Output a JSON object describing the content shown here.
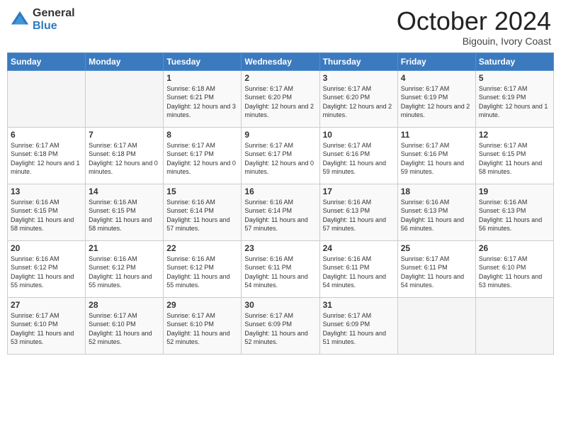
{
  "logo": {
    "general": "General",
    "blue": "Blue"
  },
  "title": "October 2024",
  "location": "Bigouin, Ivory Coast",
  "headers": [
    "Sunday",
    "Monday",
    "Tuesday",
    "Wednesday",
    "Thursday",
    "Friday",
    "Saturday"
  ],
  "weeks": [
    [
      {
        "day": "",
        "info": ""
      },
      {
        "day": "",
        "info": ""
      },
      {
        "day": "1",
        "info": "Sunrise: 6:18 AM\nSunset: 6:21 PM\nDaylight: 12 hours and 3 minutes."
      },
      {
        "day": "2",
        "info": "Sunrise: 6:17 AM\nSunset: 6:20 PM\nDaylight: 12 hours and 2 minutes."
      },
      {
        "day": "3",
        "info": "Sunrise: 6:17 AM\nSunset: 6:20 PM\nDaylight: 12 hours and 2 minutes."
      },
      {
        "day": "4",
        "info": "Sunrise: 6:17 AM\nSunset: 6:19 PM\nDaylight: 12 hours and 2 minutes."
      },
      {
        "day": "5",
        "info": "Sunrise: 6:17 AM\nSunset: 6:19 PM\nDaylight: 12 hours and 1 minute."
      }
    ],
    [
      {
        "day": "6",
        "info": "Sunrise: 6:17 AM\nSunset: 6:18 PM\nDaylight: 12 hours and 1 minute."
      },
      {
        "day": "7",
        "info": "Sunrise: 6:17 AM\nSunset: 6:18 PM\nDaylight: 12 hours and 0 minutes."
      },
      {
        "day": "8",
        "info": "Sunrise: 6:17 AM\nSunset: 6:17 PM\nDaylight: 12 hours and 0 minutes."
      },
      {
        "day": "9",
        "info": "Sunrise: 6:17 AM\nSunset: 6:17 PM\nDaylight: 12 hours and 0 minutes."
      },
      {
        "day": "10",
        "info": "Sunrise: 6:17 AM\nSunset: 6:16 PM\nDaylight: 11 hours and 59 minutes."
      },
      {
        "day": "11",
        "info": "Sunrise: 6:17 AM\nSunset: 6:16 PM\nDaylight: 11 hours and 59 minutes."
      },
      {
        "day": "12",
        "info": "Sunrise: 6:17 AM\nSunset: 6:15 PM\nDaylight: 11 hours and 58 minutes."
      }
    ],
    [
      {
        "day": "13",
        "info": "Sunrise: 6:16 AM\nSunset: 6:15 PM\nDaylight: 11 hours and 58 minutes."
      },
      {
        "day": "14",
        "info": "Sunrise: 6:16 AM\nSunset: 6:15 PM\nDaylight: 11 hours and 58 minutes."
      },
      {
        "day": "15",
        "info": "Sunrise: 6:16 AM\nSunset: 6:14 PM\nDaylight: 11 hours and 57 minutes."
      },
      {
        "day": "16",
        "info": "Sunrise: 6:16 AM\nSunset: 6:14 PM\nDaylight: 11 hours and 57 minutes."
      },
      {
        "day": "17",
        "info": "Sunrise: 6:16 AM\nSunset: 6:13 PM\nDaylight: 11 hours and 57 minutes."
      },
      {
        "day": "18",
        "info": "Sunrise: 6:16 AM\nSunset: 6:13 PM\nDaylight: 11 hours and 56 minutes."
      },
      {
        "day": "19",
        "info": "Sunrise: 6:16 AM\nSunset: 6:13 PM\nDaylight: 11 hours and 56 minutes."
      }
    ],
    [
      {
        "day": "20",
        "info": "Sunrise: 6:16 AM\nSunset: 6:12 PM\nDaylight: 11 hours and 55 minutes."
      },
      {
        "day": "21",
        "info": "Sunrise: 6:16 AM\nSunset: 6:12 PM\nDaylight: 11 hours and 55 minutes."
      },
      {
        "day": "22",
        "info": "Sunrise: 6:16 AM\nSunset: 6:12 PM\nDaylight: 11 hours and 55 minutes."
      },
      {
        "day": "23",
        "info": "Sunrise: 6:16 AM\nSunset: 6:11 PM\nDaylight: 11 hours and 54 minutes."
      },
      {
        "day": "24",
        "info": "Sunrise: 6:16 AM\nSunset: 6:11 PM\nDaylight: 11 hours and 54 minutes."
      },
      {
        "day": "25",
        "info": "Sunrise: 6:17 AM\nSunset: 6:11 PM\nDaylight: 11 hours and 54 minutes."
      },
      {
        "day": "26",
        "info": "Sunrise: 6:17 AM\nSunset: 6:10 PM\nDaylight: 11 hours and 53 minutes."
      }
    ],
    [
      {
        "day": "27",
        "info": "Sunrise: 6:17 AM\nSunset: 6:10 PM\nDaylight: 11 hours and 53 minutes."
      },
      {
        "day": "28",
        "info": "Sunrise: 6:17 AM\nSunset: 6:10 PM\nDaylight: 11 hours and 52 minutes."
      },
      {
        "day": "29",
        "info": "Sunrise: 6:17 AM\nSunset: 6:10 PM\nDaylight: 11 hours and 52 minutes."
      },
      {
        "day": "30",
        "info": "Sunrise: 6:17 AM\nSunset: 6:09 PM\nDaylight: 11 hours and 52 minutes."
      },
      {
        "day": "31",
        "info": "Sunrise: 6:17 AM\nSunset: 6:09 PM\nDaylight: 11 hours and 51 minutes."
      },
      {
        "day": "",
        "info": ""
      },
      {
        "day": "",
        "info": ""
      }
    ]
  ]
}
